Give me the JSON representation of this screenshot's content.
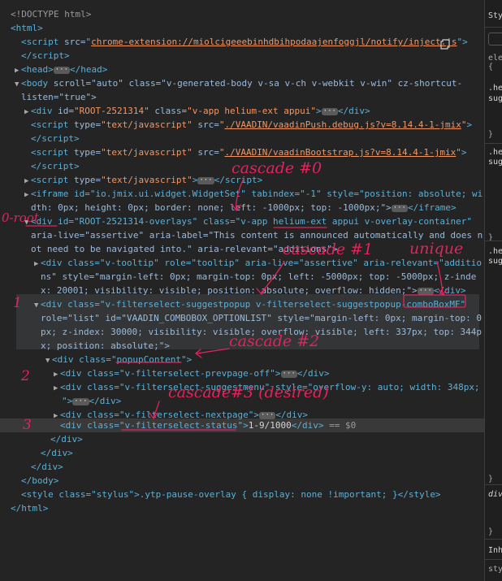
{
  "lines": {
    "doctype": "<!DOCTYPE html>",
    "html_open": "<html>",
    "script_src_attr": "src=",
    "script_src_val": "chrome-extension://miolcigeeebinhdbihpodaajenfoggjl/notify/inject.js",
    "head": "<head>",
    "head_close": "</head>",
    "body_attrs1": "scroll=\"auto\" class=\"v-generated-body v-sa v-ch v-webkit v-win\" cz-shortcut-",
    "body_attrs2": "listen=\"true\">",
    "root_id": "\"ROOT-2521314\"",
    "root_class": "\"v-app helium-ext appui\"",
    "vaadin_push_src": "./VAADIN/vaadinPush.debug.js?v=8.14.4-1-jmix",
    "vaadin_boot_src": "./VAADIN/vaadinBootstrap.js?v=8.14.4-1-jmix",
    "iframe_text": "<iframe id=\"io.jmix.ui.widget.WidgetSet\" tabindex=\"-1\" style=\"position: absolute; wi",
    "iframe_text2": "dth: 0px; height: 0px; border: none; left: -1000px; top: -1000px;\">",
    "overlays_div1": "<div id=\"ROOT-2521314-overlays\" class=\"v-app helium-ext appui v-overlay-container\"",
    "overlays_div2": "aria-live=\"assertive\" aria-label=\"This content is announced automatically and does n",
    "overlays_div3": "ot need to be navigated into.\" aria-relevant=\"additions\">",
    "tooltip1": "<div class=\"v-tooltip\" role=\"tooltip\" aria-live=\"assertive\" aria-relevant=\"additio",
    "tooltip2": "ns\" style=\"margin-left: 0px; margin-top: 0px; left: -5000px; top: -5000px; z-inde",
    "tooltip3": "x: 20001; visibility: visible; position: absolute; overflow: hidden;\">",
    "popup1": "<div class=\"v-filterselect-suggestpopup v-filterselect-suggestpopup-comboBoxMF\"",
    "popup2": "role=\"list\" id=\"VAADIN_COMBOBOX_OPTIONLIST\" style=\"margin-left: 0px; margin-top: 0",
    "popup3": "px; z-index: 30000; visibility: visible; overflow: visible; left: 337px; top: 344p",
    "popup4": "x; position: absolute;\">",
    "popup_content": "<div class=\"popupContent\">",
    "prevpage": "<div class=\"v-filterselect-prevpage-off\">",
    "suggestmenu": "<div class=\"v-filterselect-suggestmenu\" style=\"overflow-y: auto; width: 348px;",
    "suggestmenu_close": "</div>",
    "nextpage": "<div class=\"v-filterselect-nextpage\">",
    "status_open": "<div class=\"v-filterselect-status\">",
    "status_text": "1-9/1000",
    "status_close": "</div>",
    "dollar0": "== $0",
    "div_close": "</div>",
    "body_close": "</body>",
    "style_line": "<style class=\"stylus\">.ytp-pause-overlay { display: none !important; }</style>",
    "html_close": "</html>"
  },
  "annotations": {
    "cascade0": "cascade #0",
    "root": "0-root",
    "cascade1": "cascade #1",
    "unique": "unique",
    "one": "1",
    "two": "2",
    "cascade2": "cascade #2",
    "cascade3": "cascade#3 (desired)",
    "three": "3"
  },
  "styles_pane": {
    "tab": "Sty",
    "ele": "ele",
    "he1": ".he",
    "sug1": "sug",
    "he2": ".he",
    "sug2": "sug",
    "he3": ".he",
    "sug3": "sug",
    "div": "div",
    "inh": "Inh",
    "sty": "sty",
    "brace": "}"
  }
}
